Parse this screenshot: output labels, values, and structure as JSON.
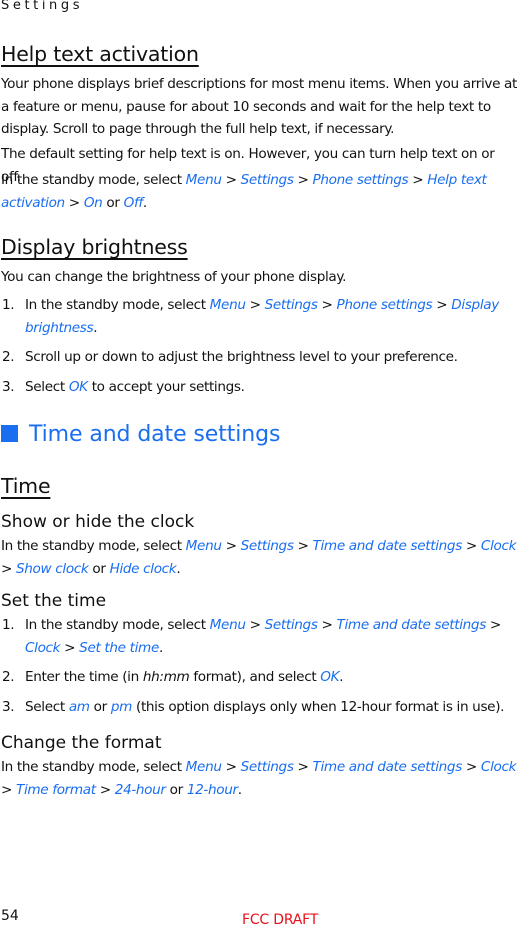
{
  "running_header": "Settings",
  "sections": {
    "help": {
      "title": "Help text activation",
      "para1": "Your phone displays brief descriptions for most menu items. When you arrive at a feature or menu, pause for about 10 seconds and wait for the help text to display. Scroll to page through the full help text, if necessary.",
      "para2": "The default setting for help text is on. However, you can turn help text on or off.",
      "para3": {
        "prefix": "In the standby mode, select ",
        "menu": "Menu",
        "settings": "Settings",
        "phone_settings": "Phone settings",
        "help_text_activation": "Help text activation",
        "on": "On",
        "or": " or ",
        "off": "Off",
        "sep": " > ",
        "end": "."
      }
    },
    "brightness": {
      "title": "Display brightness",
      "intro": "You can change the brightness of your phone display.",
      "steps": [
        {
          "num": "1.",
          "prefix": "In the standby mode, select ",
          "menu": "Menu",
          "settings": "Settings",
          "phone_settings": "Phone settings",
          "display_brightness": "Display brightness",
          "end": "."
        },
        {
          "num": "2.",
          "text": "Scroll up or down to adjust the brightness level to your preference."
        },
        {
          "num": "3.",
          "prefix": "Select ",
          "ok": "OK",
          "suffix": " to accept your settings."
        }
      ]
    },
    "time_date": {
      "title": "Time and date settings",
      "time": {
        "title": "Time",
        "show_hide": {
          "title": "Show or hide the clock",
          "prefix": "In the standby mode, select ",
          "menu": "Menu",
          "settings": "Settings",
          "time_date_settings": "Time and date settings",
          "clock": "Clock",
          "show_clock": "Show clock",
          "or": " or ",
          "hide_clock": "Hide clock",
          "end": "."
        },
        "set_time": {
          "title": "Set the time",
          "steps": [
            {
              "num": "1.",
              "prefix": "In the standby mode, select ",
              "menu": "Menu",
              "settings": "Settings",
              "time_date_settings": "Time and date settings",
              "clock": "Clock",
              "set_the_time": "Set the time",
              "end": "."
            },
            {
              "num": "2.",
              "prefix": "Enter the time (in ",
              "format": "hh:mm",
              "middle": " format), and select ",
              "ok": "OK",
              "end": "."
            },
            {
              "num": "3.",
              "prefix": "Select ",
              "am": "am",
              "or": " or ",
              "pm": "pm",
              "suffix": " (this option displays only when 12-hour format is in use)."
            }
          ]
        },
        "change_format": {
          "title": "Change the format",
          "prefix": "In the standby mode, select ",
          "menu": "Menu",
          "settings": "Settings",
          "time_date_settings": "Time and date settings",
          "clock": "Clock",
          "time_format": "Time format",
          "h24": "24-hour",
          "or": " or ",
          "h12": "12-hour",
          "end": "."
        }
      }
    }
  },
  "footer": {
    "page_number": "54",
    "draft_label": "FCC DRAFT"
  },
  "colors": {
    "link_blue": "#1a6ef0",
    "draft_red": "#e8121c",
    "text": "#111111"
  }
}
